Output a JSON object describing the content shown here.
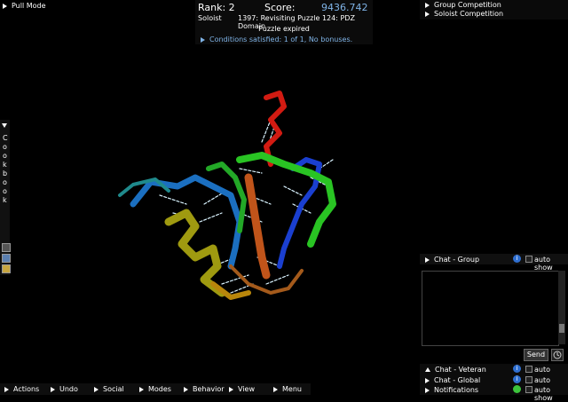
{
  "pull_mode": "Pull Mode",
  "score": {
    "rank": "Rank: 2",
    "score_label": "Score:",
    "score_value": "9436.742",
    "solo_label": "Soloist",
    "puzzle_name": "1397: Revisiting Puzzle 124: PDZ Domain",
    "puzzle_status": "Puzzle expired",
    "conditions": "Conditions satisfied: 1 of 1, No bonuses."
  },
  "competitions": [
    "Group Competition",
    "Soloist Competition"
  ],
  "cookbook_label": "Cookbook",
  "chat": {
    "group_label": "Chat - Group",
    "auto_show": "auto show",
    "send": "Send",
    "rows": [
      {
        "label": "Chat - Veteran",
        "auto": "auto show"
      },
      {
        "label": "Chat - Global",
        "auto": "auto show"
      },
      {
        "label": "Notifications",
        "auto": "auto show"
      }
    ]
  },
  "menu": [
    "Actions",
    "Undo",
    "Social",
    "Modes",
    "Behavior",
    "View",
    "Menu"
  ],
  "colors": {
    "score_value": "#7fb3e6",
    "info_icon": "#2f6fd1",
    "notification_icon": "#3cc43c"
  }
}
